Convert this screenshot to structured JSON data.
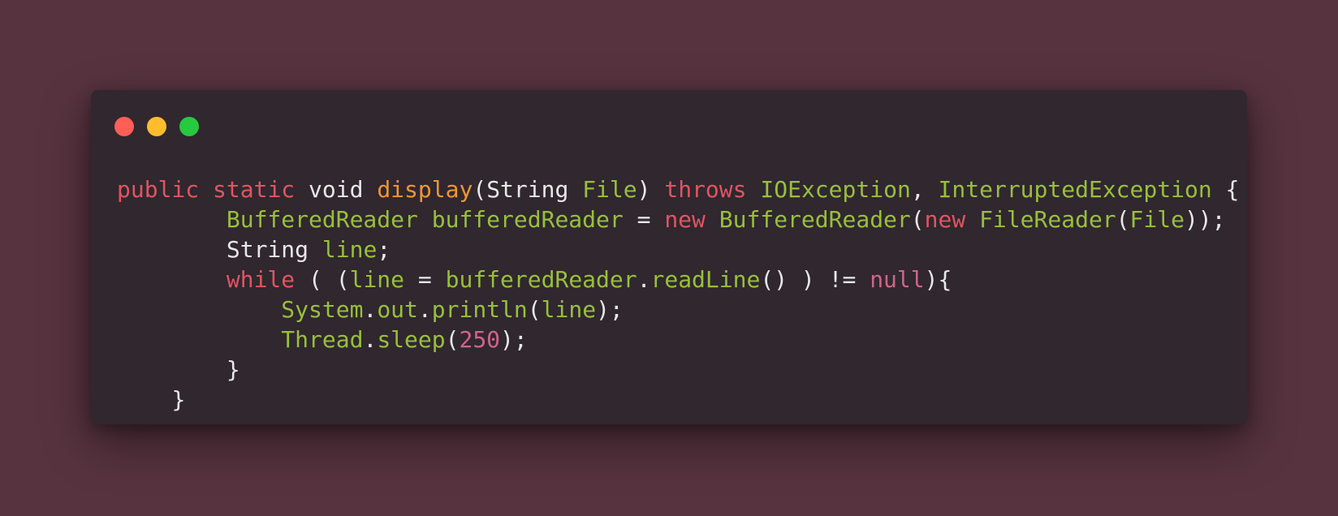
{
  "theme": {
    "background": "#57333f",
    "window_background": "#30272f",
    "traffic_lights": {
      "close": "#ff5f56",
      "minimize": "#ffbd2e",
      "maximize": "#27c93f"
    },
    "token_colors": {
      "keyword": "#e05561",
      "function": "#f0962f",
      "type": "#98c03a",
      "identifier": "#98c03a",
      "plain": "#e8e8e8",
      "number": "#d0658a",
      "null": "#d0658a"
    }
  },
  "window": {
    "controls": [
      {
        "name": "close-button",
        "icon": "red-circle"
      },
      {
        "name": "minimize-button",
        "icon": "yellow-circle"
      },
      {
        "name": "maximize-button",
        "icon": "green-circle"
      }
    ]
  },
  "code": {
    "language": "java",
    "lines": [
      {
        "indent": "",
        "tokens": [
          {
            "text": "public",
            "kind": "keyword"
          },
          {
            "text": " ",
            "kind": "plain"
          },
          {
            "text": "static",
            "kind": "keyword"
          },
          {
            "text": " void ",
            "kind": "plain"
          },
          {
            "text": "display",
            "kind": "function"
          },
          {
            "text": "(String ",
            "kind": "plain"
          },
          {
            "text": "File",
            "kind": "identifier"
          },
          {
            "text": ") ",
            "kind": "plain"
          },
          {
            "text": "throws",
            "kind": "keyword"
          },
          {
            "text": " ",
            "kind": "plain"
          },
          {
            "text": "IOException",
            "kind": "type"
          },
          {
            "text": ", ",
            "kind": "plain"
          },
          {
            "text": "InterruptedException",
            "kind": "type"
          },
          {
            "text": " {",
            "kind": "plain"
          }
        ]
      },
      {
        "indent": "        ",
        "tokens": [
          {
            "text": "BufferedReader",
            "kind": "type"
          },
          {
            "text": " ",
            "kind": "plain"
          },
          {
            "text": "bufferedReader",
            "kind": "identifier"
          },
          {
            "text": " = ",
            "kind": "plain"
          },
          {
            "text": "new",
            "kind": "keyword"
          },
          {
            "text": " ",
            "kind": "plain"
          },
          {
            "text": "BufferedReader",
            "kind": "type"
          },
          {
            "text": "(",
            "kind": "plain"
          },
          {
            "text": "new",
            "kind": "keyword"
          },
          {
            "text": " ",
            "kind": "plain"
          },
          {
            "text": "FileReader",
            "kind": "type"
          },
          {
            "text": "(",
            "kind": "plain"
          },
          {
            "text": "File",
            "kind": "identifier"
          },
          {
            "text": "));",
            "kind": "plain"
          }
        ]
      },
      {
        "indent": "        ",
        "tokens": [
          {
            "text": "String ",
            "kind": "plain"
          },
          {
            "text": "line",
            "kind": "identifier"
          },
          {
            "text": ";",
            "kind": "plain"
          }
        ]
      },
      {
        "indent": "        ",
        "tokens": [
          {
            "text": "while",
            "kind": "keyword"
          },
          {
            "text": " ( (",
            "kind": "plain"
          },
          {
            "text": "line",
            "kind": "identifier"
          },
          {
            "text": " = ",
            "kind": "plain"
          },
          {
            "text": "bufferedReader",
            "kind": "identifier"
          },
          {
            "text": ".",
            "kind": "plain"
          },
          {
            "text": "readLine",
            "kind": "identifier"
          },
          {
            "text": "() ) != ",
            "kind": "plain"
          },
          {
            "text": "null",
            "kind": "null"
          },
          {
            "text": "){",
            "kind": "plain"
          }
        ]
      },
      {
        "indent": "            ",
        "tokens": [
          {
            "text": "System",
            "kind": "type"
          },
          {
            "text": ".",
            "kind": "plain"
          },
          {
            "text": "out",
            "kind": "identifier"
          },
          {
            "text": ".",
            "kind": "plain"
          },
          {
            "text": "println",
            "kind": "identifier"
          },
          {
            "text": "(",
            "kind": "plain"
          },
          {
            "text": "line",
            "kind": "identifier"
          },
          {
            "text": ");",
            "kind": "plain"
          }
        ]
      },
      {
        "indent": "            ",
        "tokens": [
          {
            "text": "Thread",
            "kind": "type"
          },
          {
            "text": ".",
            "kind": "plain"
          },
          {
            "text": "sleep",
            "kind": "identifier"
          },
          {
            "text": "(",
            "kind": "plain"
          },
          {
            "text": "250",
            "kind": "number"
          },
          {
            "text": ");",
            "kind": "plain"
          }
        ]
      },
      {
        "indent": "        ",
        "tokens": [
          {
            "text": "}",
            "kind": "plain"
          }
        ]
      },
      {
        "indent": "    ",
        "tokens": [
          {
            "text": "}",
            "kind": "plain"
          }
        ]
      }
    ]
  }
}
